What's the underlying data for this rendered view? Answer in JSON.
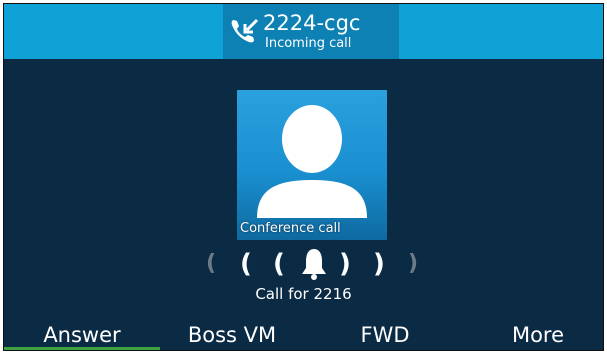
{
  "header": {
    "caller": "2224-cgc",
    "status": "Incoming call",
    "icon": "incoming-call-icon"
  },
  "contact": {
    "avatar_icon": "person-avatar-icon",
    "label": "Conference call"
  },
  "ringer": {
    "icon": "bell-icon"
  },
  "call_for": "Call for 2216",
  "softkeys": [
    {
      "label": "Answer"
    },
    {
      "label": "Boss VM"
    },
    {
      "label": "FWD"
    },
    {
      "label": "More"
    }
  ],
  "colors": {
    "background": "#0b2a44",
    "header": "#0ea2d6",
    "header_box": "#0d81b3",
    "selected_underline": "#3fa13f"
  }
}
